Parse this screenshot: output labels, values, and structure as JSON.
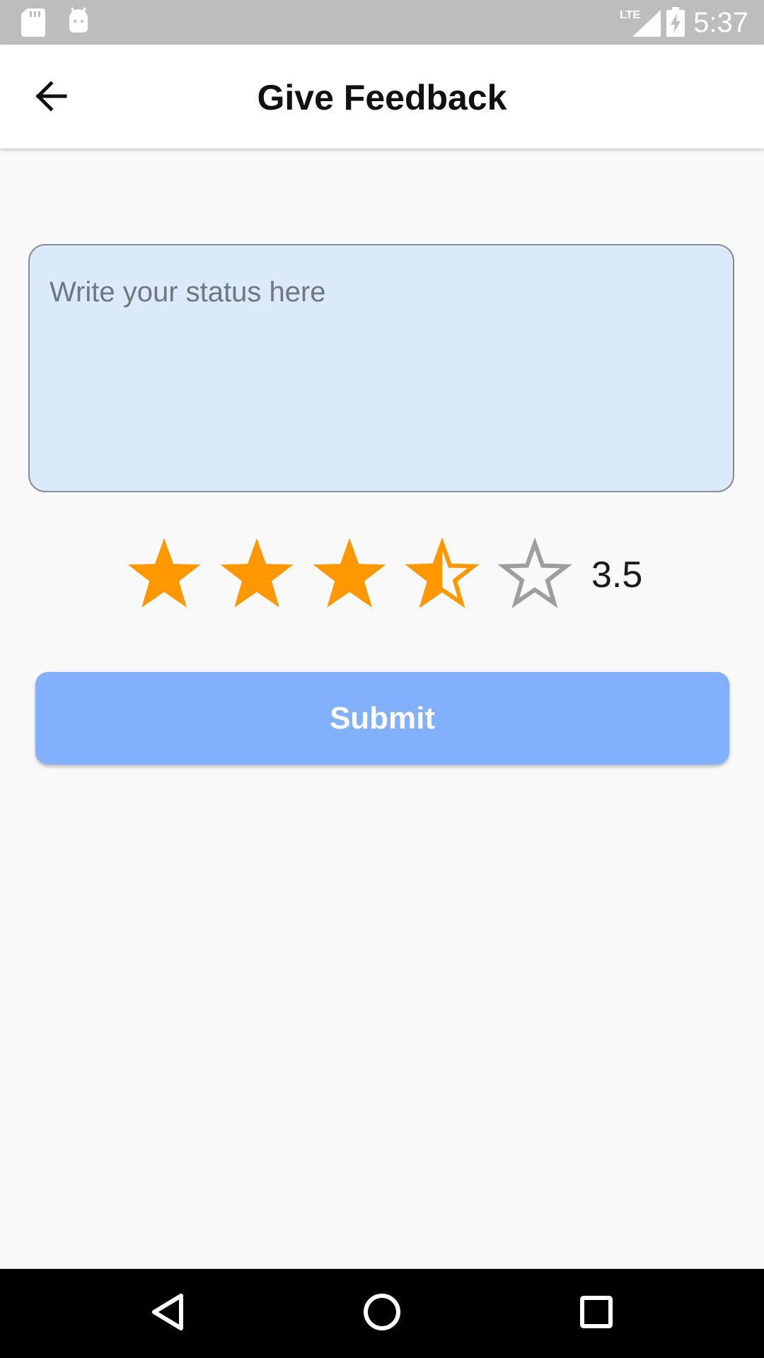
{
  "status_bar": {
    "time": "5:37",
    "network": "LTE",
    "icons": [
      "sd-card-icon",
      "android-icon",
      "lte-signal-icon",
      "battery-charging-icon"
    ]
  },
  "app_bar": {
    "title": "Give Feedback",
    "back_icon": "arrow-back-icon"
  },
  "form": {
    "status_placeholder": "Write your status here",
    "status_value": ""
  },
  "rating": {
    "value": 3.5,
    "max": 5,
    "value_label": "3.5",
    "filled_color": "#ff9800",
    "empty_color": "#9e9e9e"
  },
  "submit": {
    "label": "Submit",
    "color": "#82b0fd"
  },
  "nav_bar": {
    "icons": [
      "back-triangle-icon",
      "home-circle-icon",
      "recents-square-icon"
    ]
  }
}
